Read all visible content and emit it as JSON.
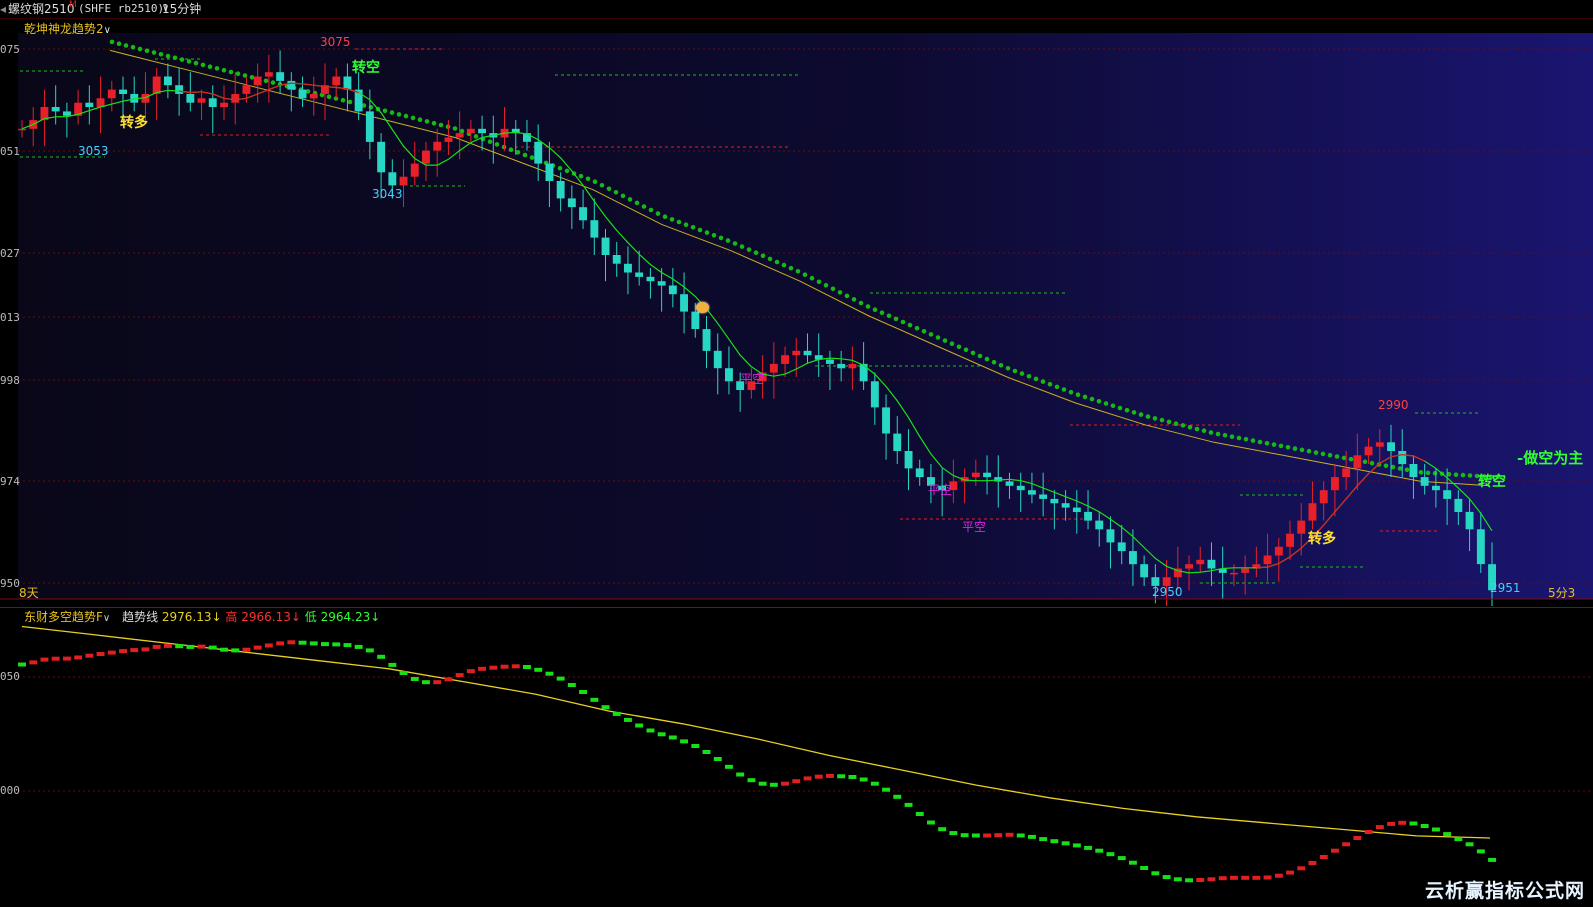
{
  "topbar": {
    "symbol": "螺纹钢2510",
    "symbol_mark": "M",
    "exchange_code": "(SHFE rb2510)",
    "period": "15分钟"
  },
  "main": {
    "indicator_name": "乾坤神龙趋势2",
    "y_labels": [
      "075",
      "051",
      "027",
      "013",
      "998",
      "974",
      "950"
    ],
    "days_label": "8天",
    "right_label": "5分3",
    "high_prices": [
      "3075",
      "2990"
    ],
    "low_prices": [
      "3053",
      "3043",
      "2950",
      "2951"
    ],
    "signals": {
      "turn_long": "转多",
      "turn_short": "转空",
      "close_short": "平空",
      "short_main": "-做空为主"
    }
  },
  "sub": {
    "indicator_name": "东财多空趋势F",
    "trend_label": "趋势线",
    "trend_value": "2976.13",
    "high_label": "高",
    "high_value": "2966.13",
    "low_label": "低",
    "low_value": "2964.23",
    "y_labels": [
      "050",
      "000"
    ]
  },
  "watermark": "云析赢指标公式网",
  "colors": {
    "up": "#e8202a",
    "down": "#27d7c4",
    "ma_green": "#18e018",
    "ma_red": "#e02020",
    "trend_yellow": "#e8d020",
    "dots": "#16b816",
    "grid": "#6a0a0a"
  },
  "chart_data": {
    "type": "candlestick",
    "close_series": [
      3058,
      3060,
      3063,
      3062,
      3061,
      3064,
      3063,
      3065,
      3067,
      3066,
      3064,
      3066,
      3070,
      3068,
      3066,
      3064,
      3065,
      3063,
      3064,
      3066,
      3068,
      3070,
      3071,
      3069,
      3067,
      3065,
      3066,
      3068,
      3070,
      3067,
      3062,
      3055,
      3048,
      3045,
      3047,
      3050,
      3053,
      3055,
      3056,
      3057,
      3058,
      3057,
      3056,
      3058,
      3057,
      3055,
      3050,
      3046,
      3042,
      3040,
      3037,
      3033,
      3029,
      3027,
      3025,
      3024,
      3023,
      3022,
      3020,
      3016,
      3012,
      3007,
      3003,
      3000,
      2998,
      3000,
      3002,
      3004,
      3006,
      3007,
      3006,
      3005,
      3004,
      3003,
      3004,
      3000,
      2994,
      2988,
      2984,
      2980,
      2978,
      2976,
      2975,
      2977,
      2978,
      2979,
      2978,
      2977,
      2976,
      2975,
      2974,
      2973,
      2972,
      2971,
      2970,
      2968,
      2966,
      2963,
      2961,
      2958,
      2955,
      2953,
      2955,
      2957,
      2958,
      2959,
      2957,
      2956,
      2956,
      2957,
      2958,
      2960,
      2962,
      2965,
      2968,
      2972,
      2975,
      2978,
      2980,
      2983,
      2985,
      2986,
      2984,
      2981,
      2978,
      2976,
      2975,
      2973,
      2970,
      2966,
      2958,
      2952
    ],
    "trend_line": [
      3076,
      3072,
      3068,
      3064,
      3060,
      3056,
      3050,
      3044,
      3036,
      3030,
      3023,
      3015,
      3008,
      3001,
      2995,
      2990,
      2986,
      2983,
      2980,
      2977,
      2976
    ],
    "price_range": [
      2950,
      3080
    ]
  }
}
